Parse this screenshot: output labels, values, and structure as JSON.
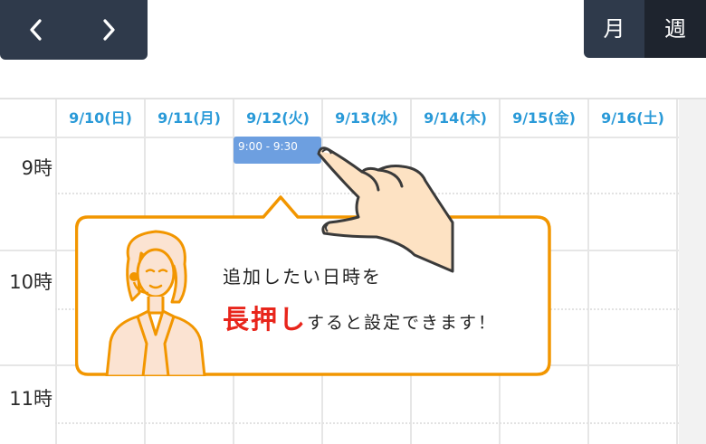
{
  "nav": {
    "prev_icon": "chevron-left-icon",
    "next_icon": "chevron-right-icon"
  },
  "view_toggle": {
    "month_label": "月",
    "week_label": "週",
    "active": "week"
  },
  "calendar": {
    "days": [
      "9/10(日)",
      "9/11(月)",
      "9/12(火)",
      "9/13(水)",
      "9/14(木)",
      "9/15(金)",
      "9/16(土)"
    ],
    "hours": [
      "9時",
      "10時",
      "11時"
    ],
    "event": {
      "time": "9:00 - 9:30",
      "day": "9/12(火)"
    }
  },
  "callout": {
    "line1": "追加したい日時を",
    "emphasis": "長押し",
    "line2_rest": "すると設定できます！"
  },
  "colors": {
    "header_bg": "#2f3a4b",
    "active_view_bg": "#1e242e",
    "day_header_text": "#2a9ad8",
    "event_bg": "#6d9fe0",
    "callout_border": "#f29600",
    "emphasis_text": "#e8251b"
  }
}
